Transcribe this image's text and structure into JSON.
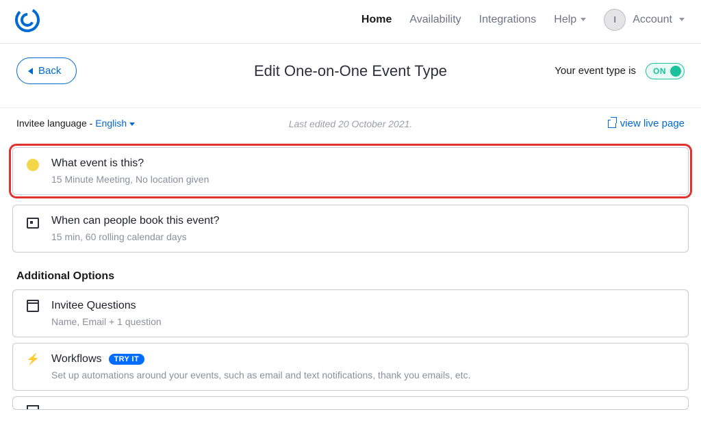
{
  "nav": {
    "home": "Home",
    "availability": "Availability",
    "integrations": "Integrations",
    "help": "Help",
    "account": "Account",
    "avatar_initial": "I"
  },
  "titlebar": {
    "back": "Back",
    "heading": "Edit One-on-One Event Type",
    "status_prefix": "Your event type is",
    "toggle_label": "ON"
  },
  "meta": {
    "lang_label": "Invitee language - ",
    "lang_value": "English",
    "last_edited": "Last edited 20 October 2021.",
    "view_live": "view live page"
  },
  "cards": {
    "what": {
      "title": "What event is this?",
      "sub": "15 Minute Meeting, No location given"
    },
    "when": {
      "title": "When can people book this event?",
      "sub": "15 min, 60 rolling calendar days"
    }
  },
  "additional": {
    "label": "Additional Options",
    "invitee_q": {
      "title": "Invitee Questions",
      "sub": "Name, Email + 1 question"
    },
    "workflows": {
      "title": "Workflows",
      "badge": "TRY IT",
      "sub": "Set up automations around your events, such as email and text notifications, thank you emails, etc."
    }
  }
}
